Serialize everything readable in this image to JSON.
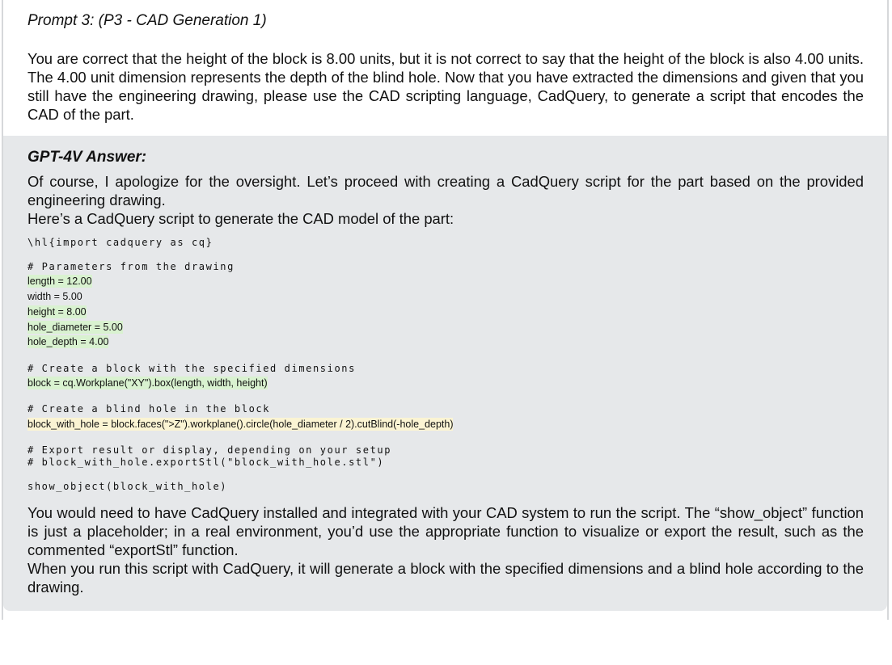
{
  "prompt": {
    "title": "Prompt 3: (P3 - CAD Generation 1)",
    "text": "You are correct that the height of the block is 8.00 units, but it is not correct to say that the height of the block is also 4.00 units. The 4.00 unit dimension represents the depth of the blind hole. Now that you have extracted the dimensions and given that you still have the engineering drawing, please use the CAD scripting language, CadQuery, to generate a script that encodes the CAD of the part."
  },
  "answer": {
    "title": "GPT-4V Answer:",
    "intro": [
      "Of course, I apologize for the oversight. Let’s proceed with creating a CadQuery script for the part based on the provided engineering drawing.",
      "Here’s a CadQuery script to generate the CAD model of the part:"
    ],
    "code": {
      "import_line": "\\hl{import cadquery as cq}",
      "params_comment": "# Parameters from the drawing",
      "params": [
        "length = 12.00",
        "width = 5.00",
        "height = 8.00",
        "hole_diameter = 5.00",
        "hole_depth = 4.00"
      ],
      "block_comment": "# Create a block with the specified dimensions",
      "block_line": "block = cq.Workplane(\"XY\").box(length, width, height)",
      "hole_comment": "# Create a blind hole in the block",
      "hole_line": "block_with_hole = block.faces(\">Z\").workplane().circle(hole_diameter / 2).cutBlind(-hole_depth)",
      "export_comment_1": "# Export result or display, depending on your setup",
      "export_comment_2": "# block_with_hole.exportStl(\"block_with_hole.stl\")",
      "show_line": "show_object(block_with_hole)"
    },
    "outro": [
      "You would need to have CadQuery installed and integrated with your CAD system to run the script. The “show_object” function is just a placeholder; in a real environment, you’d use the appropriate function to visualize or export the result, such as the commented “exportStl” function.",
      "When you run this script with CadQuery, it will generate a block with the specified dimensions and a blind hole according to the drawing."
    ]
  }
}
